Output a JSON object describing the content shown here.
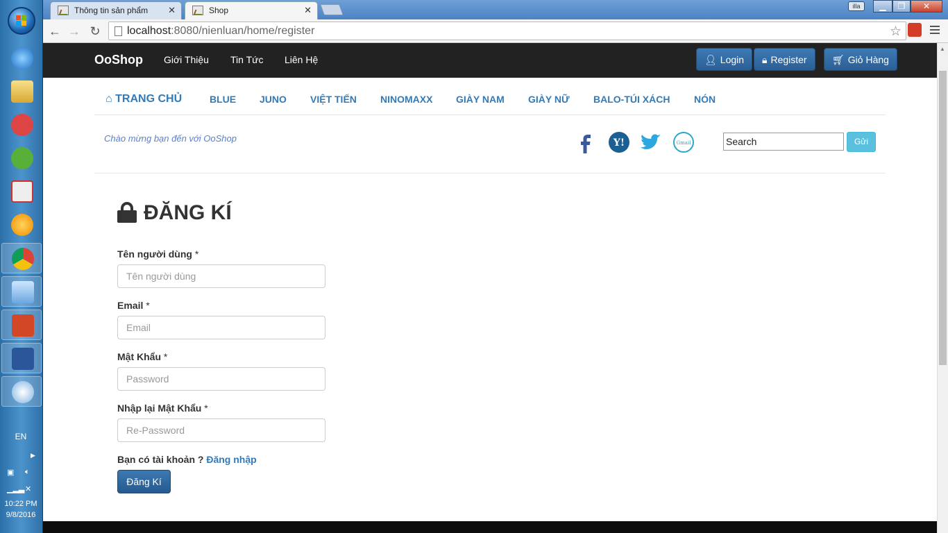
{
  "os": {
    "language": "EN",
    "clock_time": "10:22 PM",
    "clock_date": "9/8/2016",
    "taskbar_icons": [
      "internet-explorer-icon",
      "file-explorer-icon",
      "snipping-icon",
      "app-icon",
      "unikey-icon",
      "media-player-icon",
      "chrome-icon",
      "virtualbox-icon",
      "powerpoint-icon",
      "word-icon",
      "paint-icon"
    ]
  },
  "browser": {
    "tabs": [
      {
        "title": "Thông tin sản phẩm",
        "active": false
      },
      {
        "title": "Shop",
        "active": true
      }
    ],
    "url_host": "localhost",
    "url_rest": ":8080/nienluan/home/register",
    "window_user": "illa"
  },
  "site": {
    "brand": "OoShop",
    "top_links": [
      "Giới Thiệu",
      "Tin Tức",
      "Liên Hệ"
    ],
    "login_label": "Login",
    "register_label": "Register",
    "cart_label": "Giỏ Hàng",
    "home_label": "TRANG CHỦ",
    "categories": [
      "BLUE",
      "JUNO",
      "VIỆT TIẾN",
      "NINOMAXX",
      "GIÀY NAM",
      "GIÀY NỮ",
      "BALO-TÚI XÁCH",
      "NÓN"
    ],
    "welcome": "Chào mừng bạn đến với OoShop",
    "social": [
      "facebook-icon",
      "yahoo-icon",
      "twitter-icon",
      "gmail-icon"
    ],
    "search_value": "Search",
    "search_button": "Gửi"
  },
  "register": {
    "title": "ĐĂNG KÍ",
    "fields": [
      {
        "label": "Tên người dùng",
        "placeholder": "Tên người dùng"
      },
      {
        "label": "Email",
        "placeholder": "Email"
      },
      {
        "label": "Mật Khẩu",
        "placeholder": "Password"
      },
      {
        "label": "Nhập lại Mật Khẩu",
        "placeholder": "Re-Password"
      }
    ],
    "required_mark": "*",
    "account_question": "Bạn có tài khoản ?",
    "login_link": "Đăng nhập",
    "submit_label": "Đăng Kí"
  }
}
